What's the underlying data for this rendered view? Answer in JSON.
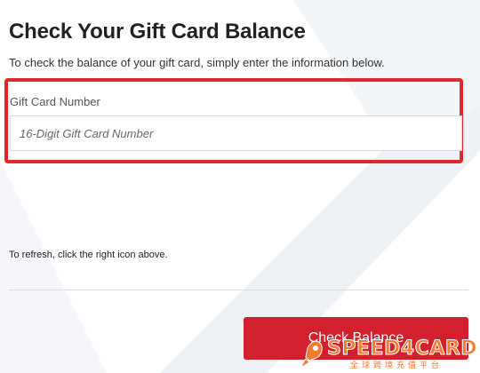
{
  "page": {
    "title": "Check Your Gift Card Balance",
    "subtitle": "To check the balance of your gift card, simply enter the information below."
  },
  "form": {
    "card_number_label": "Gift Card Number",
    "card_number_placeholder": "16-Digit Gift Card Number",
    "card_number_value": ""
  },
  "refresh_note": "To refresh, click the right icon above.",
  "actions": {
    "check_balance_label": "Check Balance"
  },
  "watermark": {
    "brand_prefix": "SPEED",
    "brand_digit": "4",
    "brand_suffix": "CARD",
    "tagline": "全球跨境充值平台"
  },
  "colors": {
    "accent_red": "#d3202f",
    "highlight_red": "#e0282c",
    "watermark_orange": "#f27b2f"
  },
  "icons": [
    "rocket-icon"
  ]
}
